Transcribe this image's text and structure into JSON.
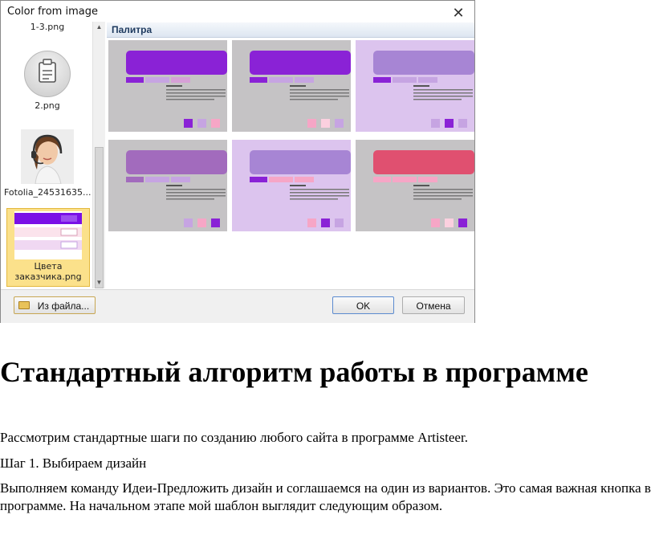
{
  "dialog": {
    "title": "Color from image",
    "close_glyph": "✕",
    "palette_title": "Палитра",
    "files": [
      {
        "caption": "1-3.png"
      },
      {
        "caption": "2.png"
      },
      {
        "caption": "Fotolia_24531635..."
      },
      {
        "caption_line1": "Цвета",
        "caption_line2": "заказчика.png"
      }
    ],
    "buttons": {
      "from_file": "Из файла...",
      "ok": "OK",
      "cancel": "Отмена"
    },
    "palettes": [
      {
        "bg": "#c5c3c5",
        "band": "#8a22d6",
        "menu": [
          "#8a22d6",
          "#c6a4e2",
          "#d6a0d6"
        ],
        "swatches": [
          "#8a22d6",
          "#c6a4e2",
          "#f6a6c6"
        ]
      },
      {
        "bg": "#c5c3c5",
        "band": "#8a22d6",
        "menu": [
          "#8a22d6",
          "#c6a4e2",
          "#c6a4e2"
        ],
        "swatches": [
          "#f6a6c6",
          "#fbd0df",
          "#c6a4e2"
        ]
      },
      {
        "bg": "#dcc4ee",
        "band": "#a785d4",
        "menu": [
          "#8a22d6",
          "#c6a4e2",
          "#c6a4e2"
        ],
        "swatches": [
          "#c6a4e2",
          "#8a22d6",
          "#c6a4e2"
        ]
      },
      {
        "bg": "#c5c3c5",
        "band": "#a26bbd",
        "menu": [
          "#a26bbd",
          "#c6a4e2",
          "#c6a4e2"
        ],
        "swatches": [
          "#c6a4e2",
          "#f6a6c6",
          "#8a22d6"
        ]
      },
      {
        "bg": "#dcc4ee",
        "band": "#a785d4",
        "menu": [
          "#8a22d6",
          "#f6a6c6",
          "#f6a6c6"
        ],
        "swatches": [
          "#f6a6c6",
          "#8a22d6",
          "#c6a4e2"
        ]
      },
      {
        "bg": "#c5c3c5",
        "band": "#e05070",
        "menu": [
          "#f6a6c6",
          "#f6a6c6",
          "#f6a6c6"
        ],
        "swatches": [
          "#f6a6c6",
          "#fbd0df",
          "#8a22d6"
        ]
      }
    ]
  },
  "document": {
    "heading": "Стандартный алгоритм работы в программе",
    "paragraphs": [
      "Рассмотрим стандартные шаги по созданию любого сайта в программе Artisteer.",
      "Шаг 1. Выбираем дизайн",
      "Выполняем команду Идеи-Предложить дизайн и соглашаемся на один из вариантов. Это самая важная кнопка в программе. На начальном этапе мой шаблон выглядит следующим образом."
    ]
  }
}
